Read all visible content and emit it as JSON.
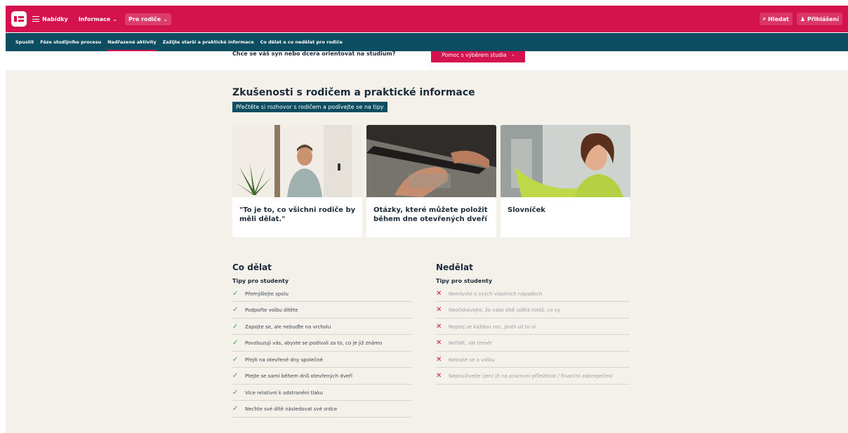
{
  "topbar": {
    "menu_label": "Nabídky",
    "nav": [
      {
        "label": "Informace",
        "dropdown": "⌄"
      },
      {
        "label": "Pro rodiče",
        "dropdown": "⌄"
      }
    ],
    "search_label": "Hledat",
    "login_label": "Přihlášení",
    "brand_color": "#d4134e"
  },
  "subnav": {
    "items": [
      {
        "label": "Spustit"
      },
      {
        "label": "Fáze studijního procesu"
      },
      {
        "label": "Nadřazené aktivity"
      },
      {
        "label": "Zažijte starší a praktické informace"
      },
      {
        "label": "Co dělat a co nedělat pro rodiče"
      }
    ],
    "active_index": 2
  },
  "banner": {
    "question": "Chce se váš syn nebo dcera orientovat na studium?",
    "cta_label": "Pomoc s výběrem studia",
    "cta_arrow": "›"
  },
  "section": {
    "title": "Zkušenosti s rodičem a praktické informace",
    "subtitle": "Přečtěte si rozhovor s rodičem a podívejte se na tipy"
  },
  "cards": [
    {
      "title": "\"To je to, co všichni rodiče by měli dělat.\""
    },
    {
      "title": "Otázky, které můžete položit během dne otevřených dveří"
    },
    {
      "title": "Slovníček"
    }
  ],
  "do": {
    "heading": "Co dělat",
    "subheading": "Tipy pro studenty",
    "items": [
      "Přemýšlejte spolu",
      "Podpořte volbu dítěte",
      "Zapojte se, ale nebuďte na vrcholu",
      "Povzbuzuji vás, abyste se podívali za to, co je již známo",
      "Přejít na otevřené dny společně",
      "Ptejte se sami během dnů otevřených dveří",
      "Více relativní k odstranění tlaku",
      "Nechte své dítě následovat své srdce"
    ]
  },
  "dont": {
    "heading": "Nedělat",
    "subheading": "Tipy pro studenty",
    "items": [
      "Nemluvte o svých vlastních nápadech",
      "Neočekávejte, že vaše dítě udělá totéž, co vy",
      "Neptej se každou noc, jestli už to ví.",
      "Neřídit, ale trenér",
      "Nebojte se o volbu",
      "Nepoužívejte (jen) jít na pracovní příležitost / finanční zabezpečení"
    ]
  }
}
